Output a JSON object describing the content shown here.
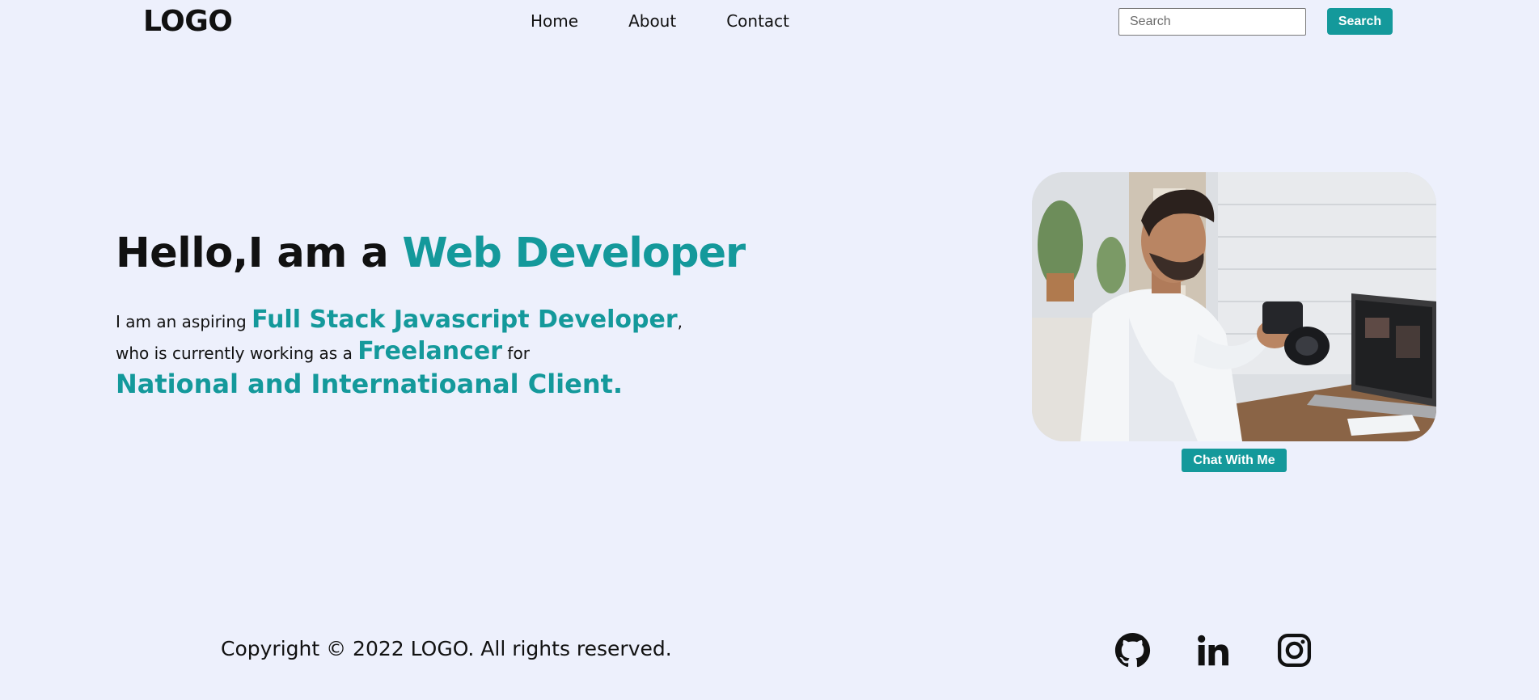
{
  "header": {
    "logo": "LOGO",
    "nav": [
      "Home",
      "About",
      "Contact"
    ],
    "search_placeholder": "Search",
    "search_button": "Search"
  },
  "hero": {
    "title_prefix": "Hello,I am a ",
    "title_accent": "Web Developer",
    "line1_prefix": "I am an aspiring ",
    "line1_accent": "Full Stack Javascript Developer",
    "line1_suffix": ",",
    "line2_prefix": "who is currently working as a ",
    "line2_accent": "Freelancer",
    "line2_suffix": " for",
    "line3_accent": "National and Internatioanal Client."
  },
  "photo": {
    "icon": "developer-photo"
  },
  "chat_button": "Chat With Me",
  "footer": {
    "copyright": "Copyright © 2022 LOGO. All rights reserved.",
    "social": [
      "github-icon",
      "linkedin-icon",
      "instagram-icon"
    ]
  },
  "colors": {
    "accent": "#14999b",
    "background": "#edf0fc",
    "text": "#111111"
  }
}
